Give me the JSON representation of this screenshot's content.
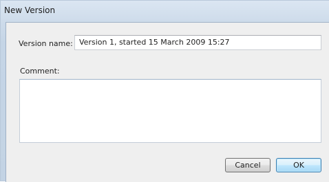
{
  "window": {
    "title": "New Version"
  },
  "form": {
    "version_name_label": "Version name:",
    "version_name_value": "Version 1, started 15 March 2009 15:27",
    "comment_label": "Comment:",
    "comment_value": ""
  },
  "buttons": {
    "cancel_label": "Cancel",
    "ok_label": "OK"
  },
  "colors": {
    "frame": "#c5d5e6",
    "client": "#efefef",
    "ok_button_border": "#3c7fb1"
  }
}
